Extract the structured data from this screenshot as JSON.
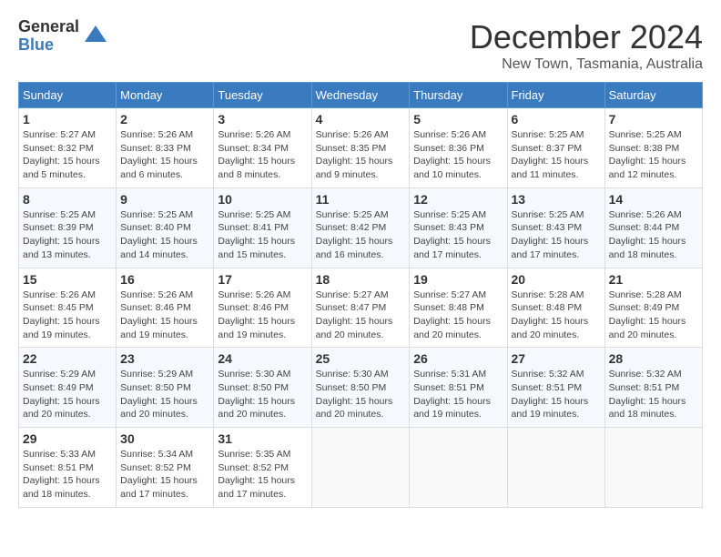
{
  "logo": {
    "general": "General",
    "blue": "Blue"
  },
  "header": {
    "month": "December 2024",
    "location": "New Town, Tasmania, Australia"
  },
  "weekdays": [
    "Sunday",
    "Monday",
    "Tuesday",
    "Wednesday",
    "Thursday",
    "Friday",
    "Saturday"
  ],
  "weeks": [
    [
      {
        "day": "1",
        "sunrise": "5:27 AM",
        "sunset": "8:32 PM",
        "daylight": "15 hours and 5 minutes."
      },
      {
        "day": "2",
        "sunrise": "5:26 AM",
        "sunset": "8:33 PM",
        "daylight": "15 hours and 6 minutes."
      },
      {
        "day": "3",
        "sunrise": "5:26 AM",
        "sunset": "8:34 PM",
        "daylight": "15 hours and 8 minutes."
      },
      {
        "day": "4",
        "sunrise": "5:26 AM",
        "sunset": "8:35 PM",
        "daylight": "15 hours and 9 minutes."
      },
      {
        "day": "5",
        "sunrise": "5:26 AM",
        "sunset": "8:36 PM",
        "daylight": "15 hours and 10 minutes."
      },
      {
        "day": "6",
        "sunrise": "5:25 AM",
        "sunset": "8:37 PM",
        "daylight": "15 hours and 11 minutes."
      },
      {
        "day": "7",
        "sunrise": "5:25 AM",
        "sunset": "8:38 PM",
        "daylight": "15 hours and 12 minutes."
      }
    ],
    [
      {
        "day": "8",
        "sunrise": "5:25 AM",
        "sunset": "8:39 PM",
        "daylight": "15 hours and 13 minutes."
      },
      {
        "day": "9",
        "sunrise": "5:25 AM",
        "sunset": "8:40 PM",
        "daylight": "15 hours and 14 minutes."
      },
      {
        "day": "10",
        "sunrise": "5:25 AM",
        "sunset": "8:41 PM",
        "daylight": "15 hours and 15 minutes."
      },
      {
        "day": "11",
        "sunrise": "5:25 AM",
        "sunset": "8:42 PM",
        "daylight": "15 hours and 16 minutes."
      },
      {
        "day": "12",
        "sunrise": "5:25 AM",
        "sunset": "8:43 PM",
        "daylight": "15 hours and 17 minutes."
      },
      {
        "day": "13",
        "sunrise": "5:25 AM",
        "sunset": "8:43 PM",
        "daylight": "15 hours and 17 minutes."
      },
      {
        "day": "14",
        "sunrise": "5:26 AM",
        "sunset": "8:44 PM",
        "daylight": "15 hours and 18 minutes."
      }
    ],
    [
      {
        "day": "15",
        "sunrise": "5:26 AM",
        "sunset": "8:45 PM",
        "daylight": "15 hours and 19 minutes."
      },
      {
        "day": "16",
        "sunrise": "5:26 AM",
        "sunset": "8:46 PM",
        "daylight": "15 hours and 19 minutes."
      },
      {
        "day": "17",
        "sunrise": "5:26 AM",
        "sunset": "8:46 PM",
        "daylight": "15 hours and 19 minutes."
      },
      {
        "day": "18",
        "sunrise": "5:27 AM",
        "sunset": "8:47 PM",
        "daylight": "15 hours and 20 minutes."
      },
      {
        "day": "19",
        "sunrise": "5:27 AM",
        "sunset": "8:48 PM",
        "daylight": "15 hours and 20 minutes."
      },
      {
        "day": "20",
        "sunrise": "5:28 AM",
        "sunset": "8:48 PM",
        "daylight": "15 hours and 20 minutes."
      },
      {
        "day": "21",
        "sunrise": "5:28 AM",
        "sunset": "8:49 PM",
        "daylight": "15 hours and 20 minutes."
      }
    ],
    [
      {
        "day": "22",
        "sunrise": "5:29 AM",
        "sunset": "8:49 PM",
        "daylight": "15 hours and 20 minutes."
      },
      {
        "day": "23",
        "sunrise": "5:29 AM",
        "sunset": "8:50 PM",
        "daylight": "15 hours and 20 minutes."
      },
      {
        "day": "24",
        "sunrise": "5:30 AM",
        "sunset": "8:50 PM",
        "daylight": "15 hours and 20 minutes."
      },
      {
        "day": "25",
        "sunrise": "5:30 AM",
        "sunset": "8:50 PM",
        "daylight": "15 hours and 20 minutes."
      },
      {
        "day": "26",
        "sunrise": "5:31 AM",
        "sunset": "8:51 PM",
        "daylight": "15 hours and 19 minutes."
      },
      {
        "day": "27",
        "sunrise": "5:32 AM",
        "sunset": "8:51 PM",
        "daylight": "15 hours and 19 minutes."
      },
      {
        "day": "28",
        "sunrise": "5:32 AM",
        "sunset": "8:51 PM",
        "daylight": "15 hours and 18 minutes."
      }
    ],
    [
      {
        "day": "29",
        "sunrise": "5:33 AM",
        "sunset": "8:51 PM",
        "daylight": "15 hours and 18 minutes."
      },
      {
        "day": "30",
        "sunrise": "5:34 AM",
        "sunset": "8:52 PM",
        "daylight": "15 hours and 17 minutes."
      },
      {
        "day": "31",
        "sunrise": "5:35 AM",
        "sunset": "8:52 PM",
        "daylight": "15 hours and 17 minutes."
      },
      null,
      null,
      null,
      null
    ]
  ],
  "labels": {
    "sunrise": "Sunrise:",
    "sunset": "Sunset:",
    "daylight": "Daylight:"
  }
}
